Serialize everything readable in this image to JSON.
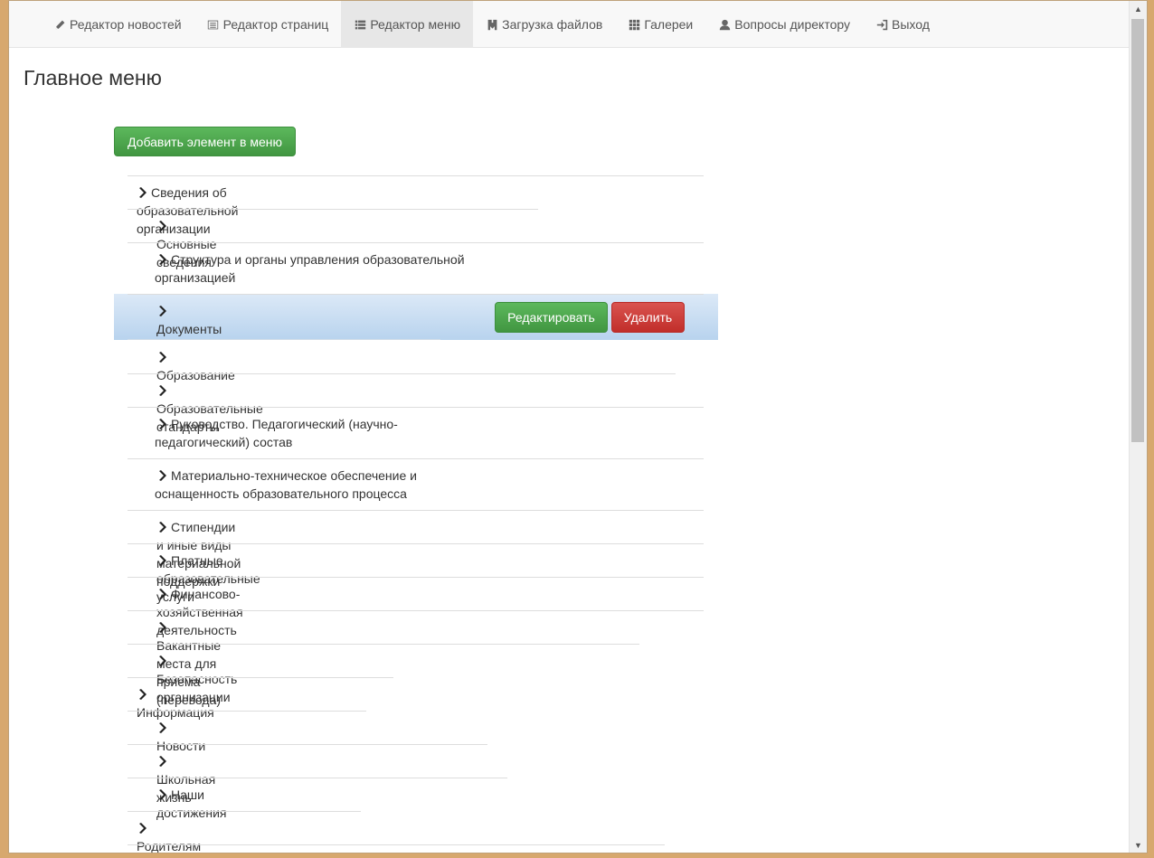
{
  "nav": {
    "items": [
      {
        "label": "Редактор новостей",
        "icon": "pencil-icon"
      },
      {
        "label": "Редактор страниц",
        "icon": "list-alt-icon"
      },
      {
        "label": "Редактор меню",
        "icon": "list-icon",
        "active": true
      },
      {
        "label": "Загрузка файлов",
        "icon": "upload-icon"
      },
      {
        "label": "Галереи",
        "icon": "grid-icon"
      },
      {
        "label": "Вопросы директору",
        "icon": "user-icon"
      },
      {
        "label": "Выход",
        "icon": "log-in-icon"
      }
    ]
  },
  "page": {
    "title": "Главное меню",
    "add_button": "Добавить элемент в меню"
  },
  "menu": {
    "items": [
      {
        "label": "Сведения об образовательной организации",
        "level": 0
      },
      {
        "label": "Основные сведения",
        "level": 1
      },
      {
        "label": "Структура и органы управления образовательной организацией",
        "level": 1
      },
      {
        "label": "Документы",
        "level": 1,
        "selected": true
      },
      {
        "label": "Образование",
        "level": 1
      },
      {
        "label": "Образовательные стандарты",
        "level": 1
      },
      {
        "label": "Руководство. Педагогический (научно-педагогический) состав",
        "level": 1
      },
      {
        "label": "Материально-техническое обеспечение и оснащенность образовательного процесса",
        "level": 1
      },
      {
        "label": "Стипендии и иные виды материальной поддержки",
        "level": 1
      },
      {
        "label": "Платные образовательные услуги",
        "level": 1
      },
      {
        "label": "Финансово-хозяйственная деятельность",
        "level": 1
      },
      {
        "label": "Вакантные места для приема (перевода)",
        "level": 1
      },
      {
        "label": "Безопасность организации",
        "level": 1
      },
      {
        "label": "Информация",
        "level": 0
      },
      {
        "label": "Новости",
        "level": 1
      },
      {
        "label": "Школьная жизнь",
        "level": 1
      },
      {
        "label": "Наши достижения",
        "level": 1
      },
      {
        "label": "Родителям",
        "level": 0
      }
    ],
    "edit_button": "Редактировать",
    "delete_button": "Удалить"
  },
  "colors": {
    "success": "#5cb85c",
    "danger": "#d9534f",
    "highlight": "#c6dcf2"
  }
}
